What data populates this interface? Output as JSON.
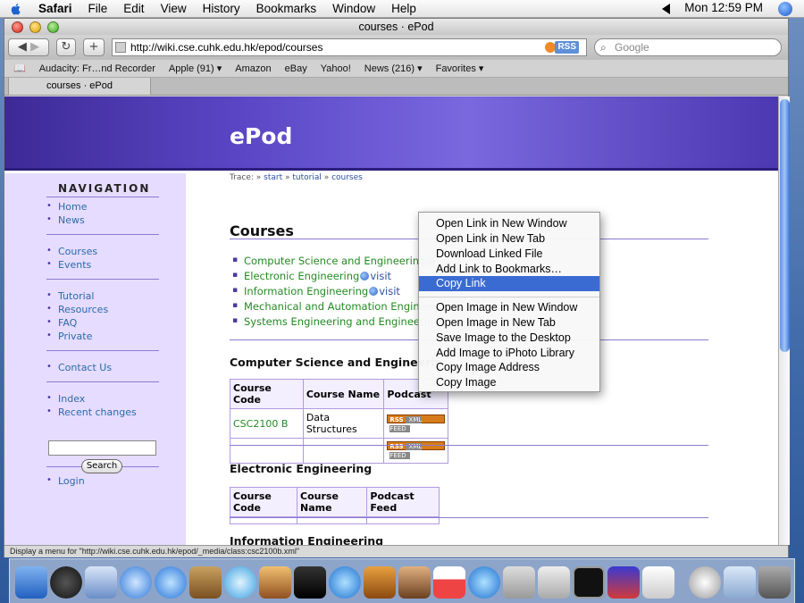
{
  "menubar": {
    "app": "Safari",
    "items": [
      "File",
      "Edit",
      "View",
      "History",
      "Bookmarks",
      "Window",
      "Help"
    ],
    "clock": "Mon 12:59 PM"
  },
  "window": {
    "title": "courses · ePod",
    "url": "http://wiki.cse.cuhk.edu.hk/epod/courses",
    "rss": "RSS",
    "search_placeholder": "Google",
    "bookmarks": [
      "Audacity: Fr…nd Recorder",
      "Apple (91) ▾",
      "Amazon",
      "eBay",
      "Yahoo!",
      "News (216) ▾",
      "Favorites ▾"
    ],
    "tab_title": "courses · ePod",
    "status": "Display a menu for \"http://wiki.cse.cuhk.edu.hk/epod/_media/class:csc2100b.xml\""
  },
  "page": {
    "site_title": "ePod",
    "trace_label": "Trace:",
    "trace": [
      "start",
      "tutorial",
      "courses"
    ],
    "nav_heading": "NAVIGATION",
    "nav_groups": [
      [
        "Home",
        "News"
      ],
      [
        "Courses",
        "Events"
      ],
      [
        "Tutorial",
        "Resources",
        "FAQ",
        "Private"
      ],
      [
        "Contact Us"
      ],
      [
        "Index",
        "Recent changes"
      ]
    ],
    "search_button": "Search",
    "login": "Login",
    "heading": "Courses",
    "course_links": [
      {
        "name": "Computer Science and Engineering",
        "visit": ""
      },
      {
        "name": "Electronic Engineering",
        "visit": "visit"
      },
      {
        "name": "Information Engineering",
        "visit": "visit"
      },
      {
        "name": "Mechanical and Automation Engineer",
        "visit": ""
      },
      {
        "name": "Systems Engineering and Engineerin",
        "visit": ""
      }
    ],
    "sections": [
      {
        "title": "Computer Science and Engineerin",
        "headers": [
          "Course Code",
          "Course Name",
          "Podcast"
        ],
        "rows": [
          [
            "CSC2100 B",
            "Data Structures",
            "feed"
          ],
          [
            "",
            "",
            "feed"
          ]
        ]
      },
      {
        "title": "Electronic Engineering",
        "headers": [
          "Course Code",
          "Course Name",
          "Podcast Feed"
        ],
        "rows": []
      },
      {
        "title": "Information Engineering",
        "headers": [],
        "rows": []
      }
    ],
    "feed_label_rss": "RSS",
    "feed_label_xml": "XML FEED"
  },
  "context_menu": {
    "items": [
      "Open Link in New Window",
      "Open Link in New Tab",
      "Download Linked File",
      "Add Link to Bookmarks…",
      "Copy Link",
      "Open Image in New Window",
      "Open Image in New Tab",
      "Save Image to the Desktop",
      "Add Image to iPhoto Library",
      "Copy Image Address",
      "Copy Image"
    ],
    "selected_index": 4
  },
  "colors": {
    "selection": "#3a6bd3",
    "link_green": "#228b22",
    "sidebar": "#e6dcff",
    "banner": "#5a46c4"
  }
}
